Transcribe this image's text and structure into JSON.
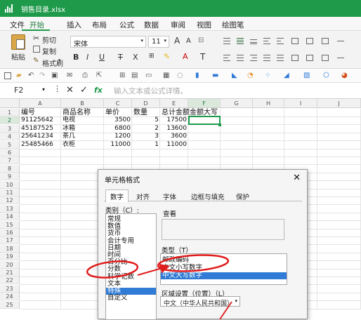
{
  "window": {
    "title": "销售目录.xlsx"
  },
  "menu": [
    {
      "label": "文件"
    },
    {
      "label": "开始"
    },
    {
      "label": "插入"
    },
    {
      "label": "布局"
    },
    {
      "label": "公式"
    },
    {
      "label": "数据"
    },
    {
      "label": "审阅"
    },
    {
      "label": "视图"
    },
    {
      "label": "绘图笔"
    }
  ],
  "ribbon": {
    "paste_label": "粘贴",
    "cut_label": "剪切",
    "copy_label": "复制",
    "format_painter_label": "格式刷",
    "font_name": "宋体",
    "font_size": "11",
    "grow_font": "A",
    "shrink_font": "A",
    "bold": "B",
    "italic": "I",
    "underline": "U",
    "strike": "T",
    "subscript": "X",
    "font_color_glyph": "A",
    "text_glyph": "T"
  },
  "formula_bar": {
    "cell_ref": "F2",
    "fx": "fx",
    "placeholder": "输入文本或公式详情。"
  },
  "sheet": {
    "columns": [
      "A",
      "B",
      "C",
      "D",
      "E",
      "F",
      "G",
      "H",
      "I",
      "J"
    ],
    "rows": [
      "1",
      "2",
      "3",
      "4",
      "5",
      "6",
      "7",
      "8",
      "9",
      "10",
      "11",
      "12",
      "13",
      "14",
      "15",
      "16",
      "17",
      "18",
      "19",
      "20",
      "21",
      "22",
      "23",
      "24",
      "25"
    ],
    "header": [
      "编号",
      "商品名称",
      "单价",
      "数量",
      "总计金额",
      "金额大写"
    ],
    "data": [
      [
        "91125642",
        "电视",
        "3500",
        "5",
        "17500"
      ],
      [
        "45187525",
        "冰箱",
        "6800",
        "2",
        "13600"
      ],
      [
        "25641234",
        "茶几",
        "1200",
        "3",
        "3600"
      ],
      [
        "25485466",
        "衣柜",
        "11000",
        "1",
        "11000"
      ]
    ],
    "selected_cell": "F2",
    "accent": "#1e9a4a"
  },
  "dialog": {
    "title": "单元格格式",
    "close": "✕",
    "tabs": [
      "数字",
      "对齐",
      "字体",
      "边框与填充",
      "保护"
    ],
    "category_label": "类别（C）:",
    "categories": [
      "常规",
      "数值",
      "货币",
      "会计专用",
      "日期",
      "时间",
      "百分比",
      "分数",
      "科学记数",
      "文本",
      "特殊",
      "自定义"
    ],
    "selected_category": "特殊",
    "preview_label": "查看",
    "type_label": "类型（T）",
    "types": [
      "邮政编码",
      "中文小写数字",
      "中文大写数字"
    ],
    "selected_type": "中文大写数字",
    "locale_label": "区域设置（位置）（L）",
    "locale_value": "中文（中华人民共和国）",
    "annotation_color": "#e01b1b",
    "selection_color": "#2f7bd5"
  }
}
